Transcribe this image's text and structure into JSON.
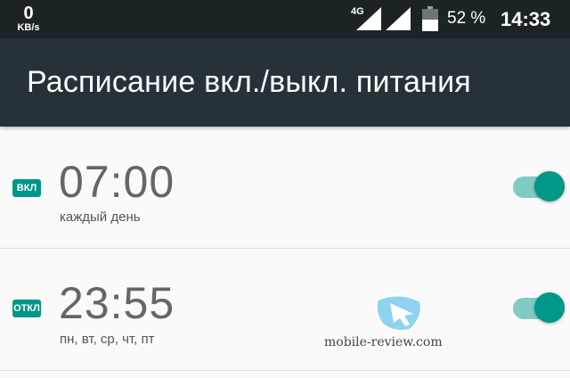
{
  "status_bar": {
    "speed_value": "0",
    "speed_unit": "KB/s",
    "network_type": "4G",
    "battery_percent": "52 %",
    "time": "14:33",
    "icons": [
      "signal-4g-icon",
      "signal-icon",
      "battery-icon"
    ]
  },
  "app_bar": {
    "title": "Расписание вкл./выкл. питания"
  },
  "schedules": [
    {
      "badge": "ВКЛ",
      "time": "07:00",
      "days": "каждый день",
      "enabled": true
    },
    {
      "badge": "ОТКЛ",
      "time": "23:55",
      "days": "пн, вт, ср, чт, пт",
      "enabled": true
    }
  ],
  "watermark": {
    "text": "mobile-review.com",
    "icon": "mobile-review-logo"
  },
  "colors": {
    "status_bar_bg": "#1b2327",
    "app_bar_bg": "#263238",
    "accent": "#009688",
    "switch_track": "#80cbc4",
    "background": "#fafafa"
  }
}
